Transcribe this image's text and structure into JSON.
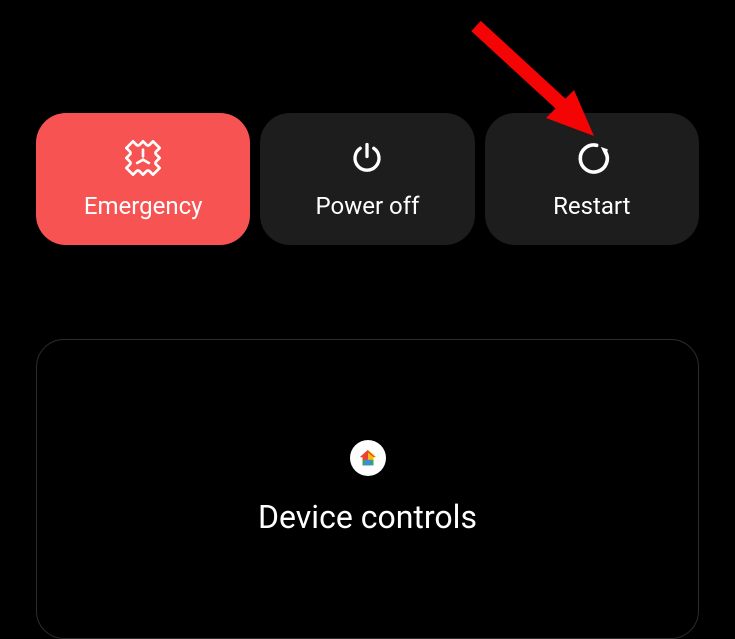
{
  "power_menu": {
    "emergency_label": "Emergency",
    "poweroff_label": "Power off",
    "restart_label": "Restart"
  },
  "controls": {
    "title": "Device controls"
  },
  "annotation": {
    "arrow_target": "restart-button",
    "arrow_color": "#f40404"
  }
}
